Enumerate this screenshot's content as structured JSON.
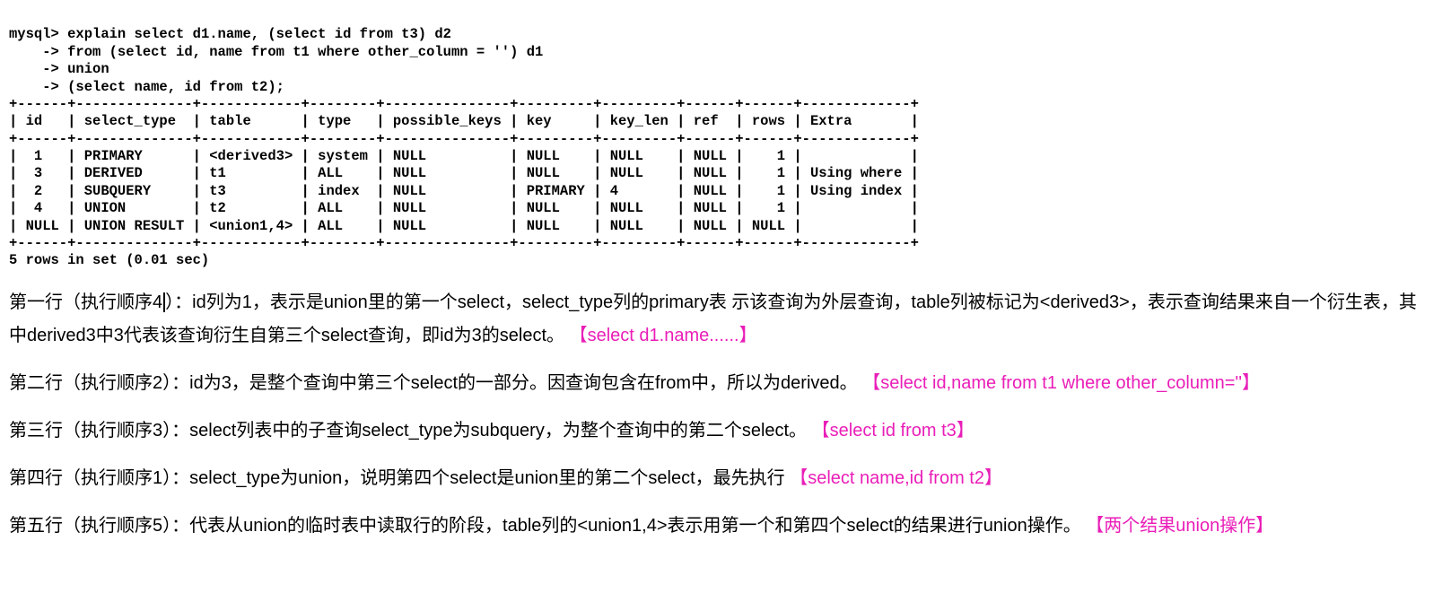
{
  "sql": {
    "prompt": "mysql>",
    "cont": "    ->",
    "l1": " explain select d1.name, (select id from t3) d2",
    "l2": " from (select id, name from t1 where other_column = '') d1",
    "l3": " union",
    "l4": " (select name, id from t2);"
  },
  "divider": "+------+--------------+------------+--------+---------------+---------+---------+------+------+-------------+",
  "header": "| id   | select_type  | table      | type   | possible_keys | key     | key_len | ref  | rows | Extra       |",
  "rows": [
    "|  1   | PRIMARY      | <derived3> | system | NULL          | NULL    | NULL    | NULL |    1 |             |",
    "|  3   | DERIVED      | t1         | ALL    | NULL          | NULL    | NULL    | NULL |    1 | Using where |",
    "|  2   | SUBQUERY     | t3         | index  | NULL          | PRIMARY | 4       | NULL |    1 | Using index |",
    "|  4   | UNION        | t2         | ALL    | NULL          | NULL    | NULL    | NULL |    1 |             |",
    "| NULL | UNION RESULT | <union1,4> | ALL    | NULL          | NULL    | NULL    | NULL | NULL |             |"
  ],
  "footer": "5 rows in set (0.01 sec)",
  "p1a": "第一行（执行顺序4",
  "p1b": "）：id列为1，表示是union里的第一个select，select_type列的primary表 示该查询为外层查询，table列被标记为<derived3>，表示查询结果来自一个衍生表，其中derived3中3代表该查询衍生自第三个select查询，即id为3的select。",
  "p1hl": "【select d1.name......】",
  "p2a": "第二行（执行顺序2）：id为3，是整个查询中第三个select的一部分。因查询包含在from中，所以为derived。",
  "p2hl": "【select id,name from t1 where other_column=''】",
  "p3a": "第三行（执行顺序3）：select列表中的子查询select_type为subquery，为整个查询中的第二个select。",
  "p3hl": "【select id from t3】",
  "p4a": "第四行（执行顺序1）：select_type为union，说明第四个select是union里的第二个select，最先执行",
  "p4hl": "【select name,id from t2】",
  "p5a": "第五行（执行顺序5）：代表从union的临时表中读取行的阶段，table列的<union1,4>表示用第一个和第四个select的结果进行union操作。",
  "p5hl": "【两个结果union操作】",
  "chart_data": {
    "type": "table",
    "headers": [
      "id",
      "select_type",
      "table",
      "type",
      "possible_keys",
      "key",
      "key_len",
      "ref",
      "rows",
      "Extra"
    ],
    "data": [
      [
        "1",
        "PRIMARY",
        "<derived3>",
        "system",
        "NULL",
        "NULL",
        "NULL",
        "NULL",
        "1",
        ""
      ],
      [
        "3",
        "DERIVED",
        "t1",
        "ALL",
        "NULL",
        "NULL",
        "NULL",
        "NULL",
        "1",
        "Using where"
      ],
      [
        "2",
        "SUBQUERY",
        "t3",
        "index",
        "NULL",
        "PRIMARY",
        "4",
        "NULL",
        "1",
        "Using index"
      ],
      [
        "4",
        "UNION",
        "t2",
        "ALL",
        "NULL",
        "NULL",
        "NULL",
        "NULL",
        "1",
        ""
      ],
      [
        "NULL",
        "UNION RESULT",
        "<union1,4>",
        "ALL",
        "NULL",
        "NULL",
        "NULL",
        "NULL",
        "NULL",
        ""
      ]
    ]
  }
}
